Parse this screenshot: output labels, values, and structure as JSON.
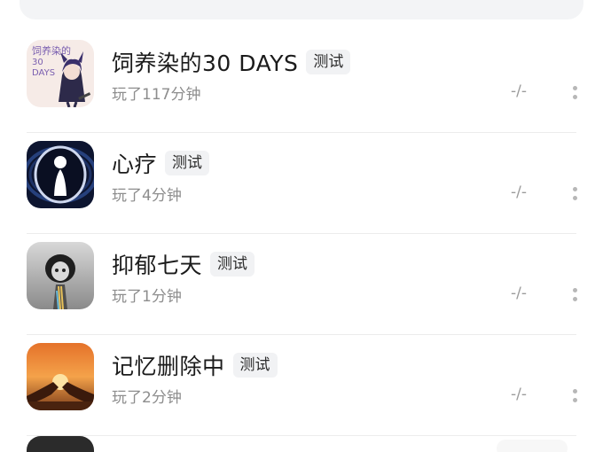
{
  "games": [
    {
      "title": "饲养染的30 DAYS",
      "tag": "测试",
      "playtime": "玩了117分钟",
      "score": "-/-",
      "thumb": "anime-girl-cover",
      "thumb_text": [
        "饲养染的",
        "30",
        "DAYS"
      ]
    },
    {
      "title": "心疗",
      "tag": "测试",
      "playtime": "玩了4分钟",
      "score": "-/-",
      "thumb": "silhouette-portal-cover"
    },
    {
      "title": "抑郁七天",
      "tag": "测试",
      "playtime": "玩了1分钟",
      "score": "-/-",
      "thumb": "sad-girl-cover"
    },
    {
      "title": "记忆删除中",
      "tag": "测试",
      "playtime": "玩了2分钟",
      "score": "-/-",
      "thumb": "sunset-hands-cover"
    }
  ],
  "colors": {
    "title": "#1b1b1b",
    "meta": "#8d8d8d",
    "tag_bg": "#f1f2f4",
    "divider": "#ececec"
  },
  "icons": {
    "more": "more-vertical-icon"
  }
}
